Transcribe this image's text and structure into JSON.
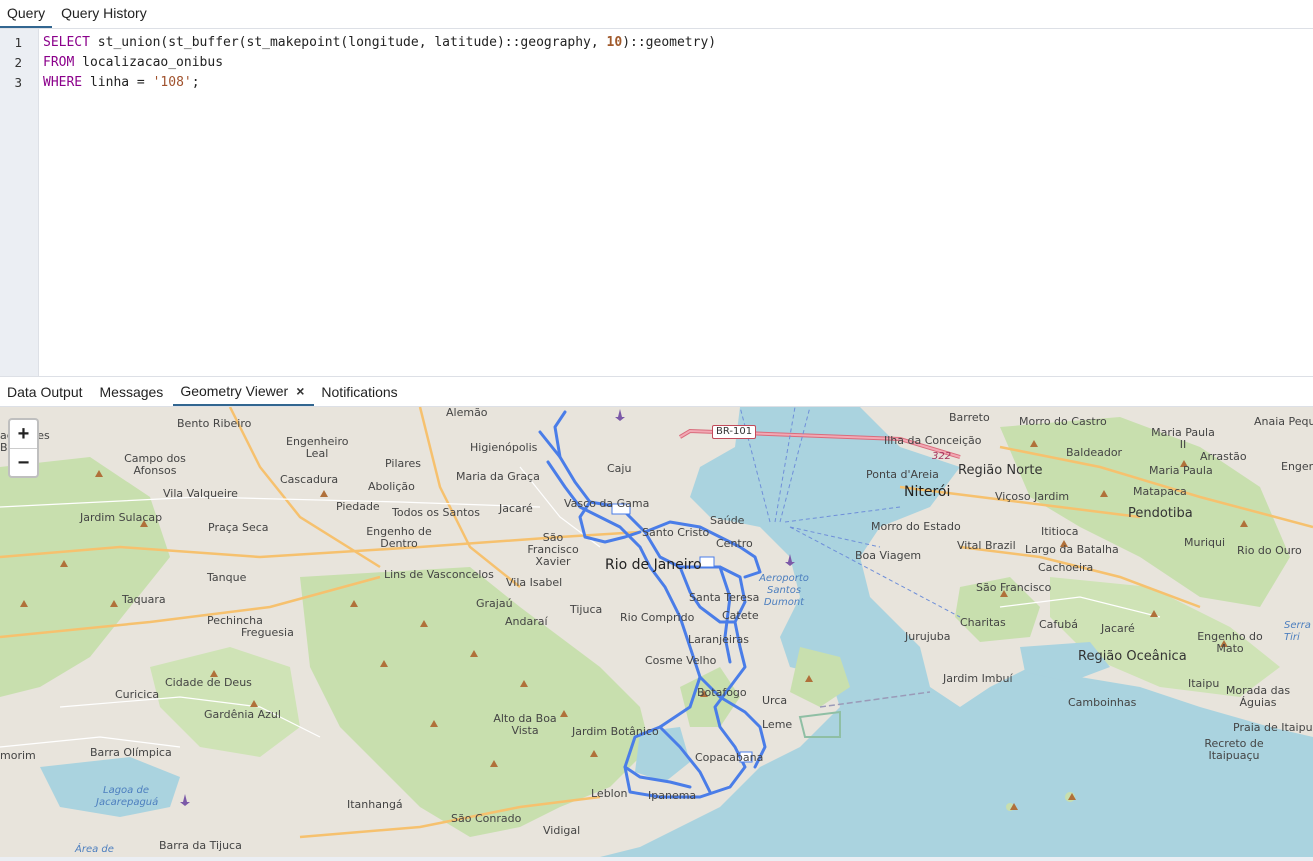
{
  "query_tabs": [
    {
      "label": "Query"
    },
    {
      "label": "Query History"
    }
  ],
  "editor": {
    "line_numbers": [
      "1",
      "2",
      "3"
    ],
    "lines": [
      {
        "kw": "SELECT",
        "text_a": " st_union(st_buffer(st_makepoint(longitude, latitude)::geography, ",
        "num": "10",
        "text_b": ")::geometry)"
      },
      {
        "kw": "FROM",
        "text_a": " localizacao_onibus"
      },
      {
        "kw": "WHERE",
        "text_a": " linha = ",
        "str": "'108'",
        "text_b": ";"
      }
    ]
  },
  "result_tabs": [
    {
      "label": "Data Output"
    },
    {
      "label": "Messages"
    },
    {
      "label": "Geometry Viewer",
      "close": "×"
    },
    {
      "label": "Notifications"
    }
  ],
  "map": {
    "zoom_in": "+",
    "zoom_out": "−",
    "labels": [
      "Alemão",
      "Bento Ribeiro",
      "Engenheiro Leal",
      "agalhães Bastos",
      "Campo dos Afonsos",
      "Cascadura",
      "Pilares",
      "Higienópolis",
      "Abolição",
      "Maria da Graça",
      "Caju",
      "Vila Valqueire",
      "Jardim Sulacap",
      "Praça Seca",
      "Piedade",
      "Todos os Santos",
      "Jacaré",
      "Vasco da Gama",
      "Engenho de Dentro",
      "São Francisco Xavier",
      "Santo Cristo",
      "Saúde",
      "Centro",
      "Rio de Janeiro",
      "Tanque",
      "Lins de Vasconcelos",
      "Vila Isabel",
      "Taquara",
      "Grajaú",
      "Tijuca",
      "Andaraí",
      "Rio Comprido",
      "Santa Teresa",
      "Catete",
      "Laranjeiras",
      "Pechincha",
      "Freguesia",
      "Cosme Velho",
      "Cidade de Deus",
      "Curicica",
      "Gardênia Azul",
      "Alto da Boa Vista",
      "Jardim Botânico",
      "Botafogo",
      "Urca",
      "Leme",
      "Copacabana",
      "Barra Olímpica",
      "Lagoa de Jacarepaguá",
      "Itanhangá",
      "São Conrado",
      "Leblon",
      "Ipanema",
      "Vidigal",
      "Barra da Tijuca",
      "Área de",
      "morim",
      "BR-101",
      "Aeroporto Santos Dumont",
      "Barreto",
      "Ilha da Conceição",
      "Morro do Castro",
      "Maria Paula II",
      "Anaia Pequ",
      "Baldeador",
      "Arrastão",
      "Engen",
      "Ponta d'Areia",
      "Região Norte",
      "Maria Paula",
      "Niterói",
      "Viçoso Jardim",
      "Matapaca",
      "Pendotiba",
      "Morro do Estado",
      "Ititioca",
      "Boa Viagem",
      "Vital Brazil",
      "Largo da Batalha",
      "Muriqui",
      "Rio do Ouro",
      "Cachoeira",
      "São Francisco",
      "Charitas",
      "Cafubá",
      "Jacaré",
      "Jurujuba",
      "Região Oceânica",
      "Engenho do Mato",
      "Serra Tiri",
      "Jardim Imbuí",
      "Camboinhas",
      "Itaipu",
      "Morada das Águias",
      "Praia de Itaipuaçu",
      "Recreto de Itaipuaçu",
      "322"
    ]
  },
  "colors": {
    "accent": "#326690",
    "route": "#4a7de8",
    "water": "#aad3df"
  }
}
